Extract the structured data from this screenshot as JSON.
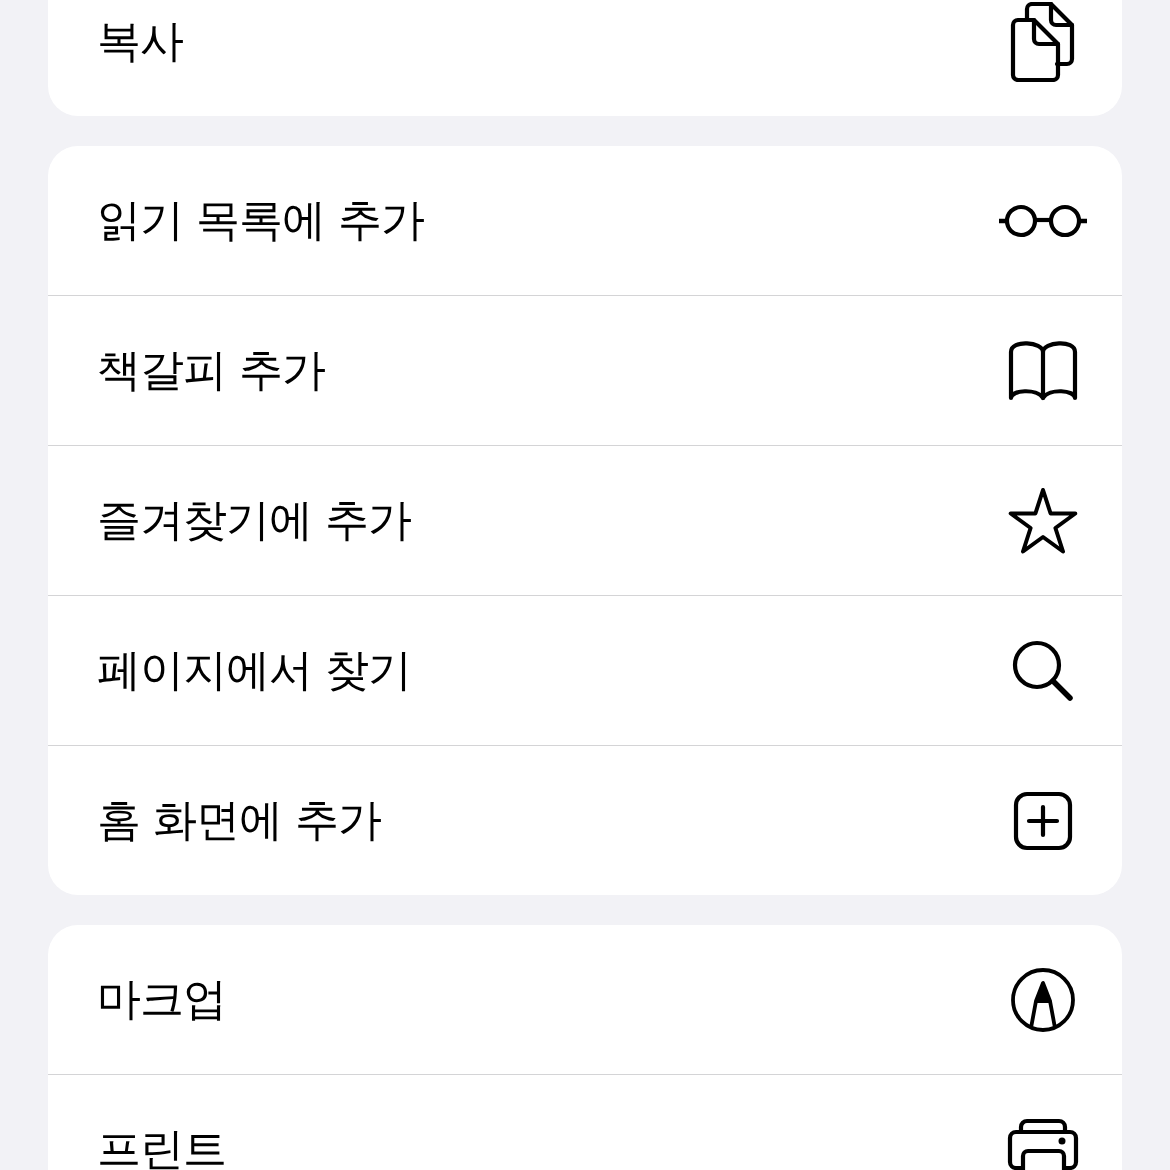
{
  "groups": [
    {
      "items": [
        {
          "label": "복사",
          "kind": "copy"
        }
      ]
    },
    {
      "items": [
        {
          "label": "읽기 목록에 추가",
          "kind": "reading-list"
        },
        {
          "label": "책갈피 추가",
          "kind": "bookmark"
        },
        {
          "label": "즐겨찾기에 추가",
          "kind": "favorite"
        },
        {
          "label": "페이지에서 찾기",
          "kind": "find"
        },
        {
          "label": "홈 화면에 추가",
          "kind": "home-screen"
        }
      ]
    },
    {
      "items": [
        {
          "label": "마크업",
          "kind": "markup"
        },
        {
          "label": "프린트",
          "kind": "print"
        }
      ]
    }
  ]
}
